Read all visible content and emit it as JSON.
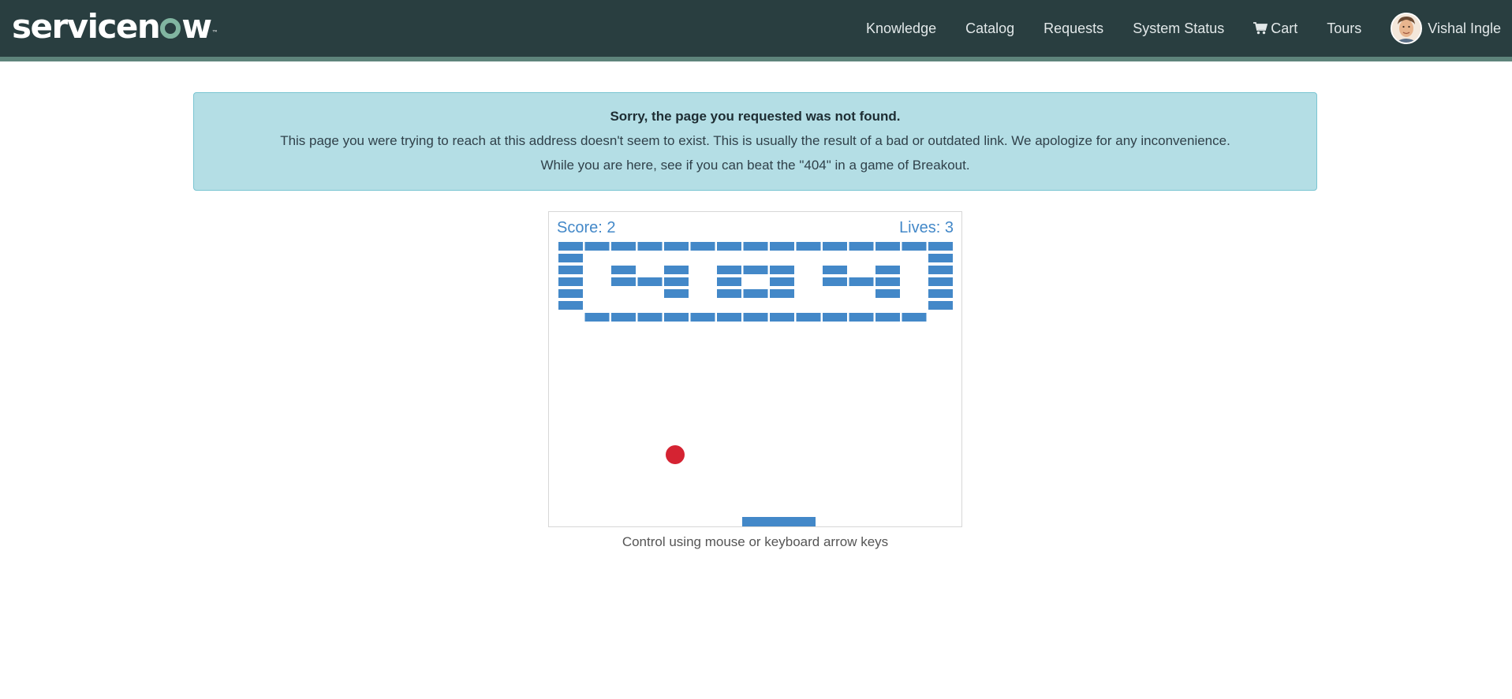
{
  "header": {
    "logo_text_1": "servicen",
    "logo_text_2": "w",
    "logo_tm": "™",
    "nav": [
      "Knowledge",
      "Catalog",
      "Requests",
      "System Status",
      "Cart",
      "Tours"
    ],
    "cart_icon": "shopping-cart-icon",
    "user_name": "Vishal Ingle"
  },
  "alert": {
    "title": "Sorry, the page you requested was not found.",
    "message": "This page you were trying to reach at this address doesn't seem to exist. This is usually the result of a bad or outdated link. We apologize for any inconvenience.",
    "game_prompt": "While you are here, see if you can beat the \"404\" in a game of Breakout."
  },
  "game": {
    "score_label": "Score: 2",
    "lives_label": "Lives: 3",
    "brick_color": "#4388c8",
    "ball_color": "#d52332",
    "hint": "Control using mouse or keyboard arrow keys"
  }
}
